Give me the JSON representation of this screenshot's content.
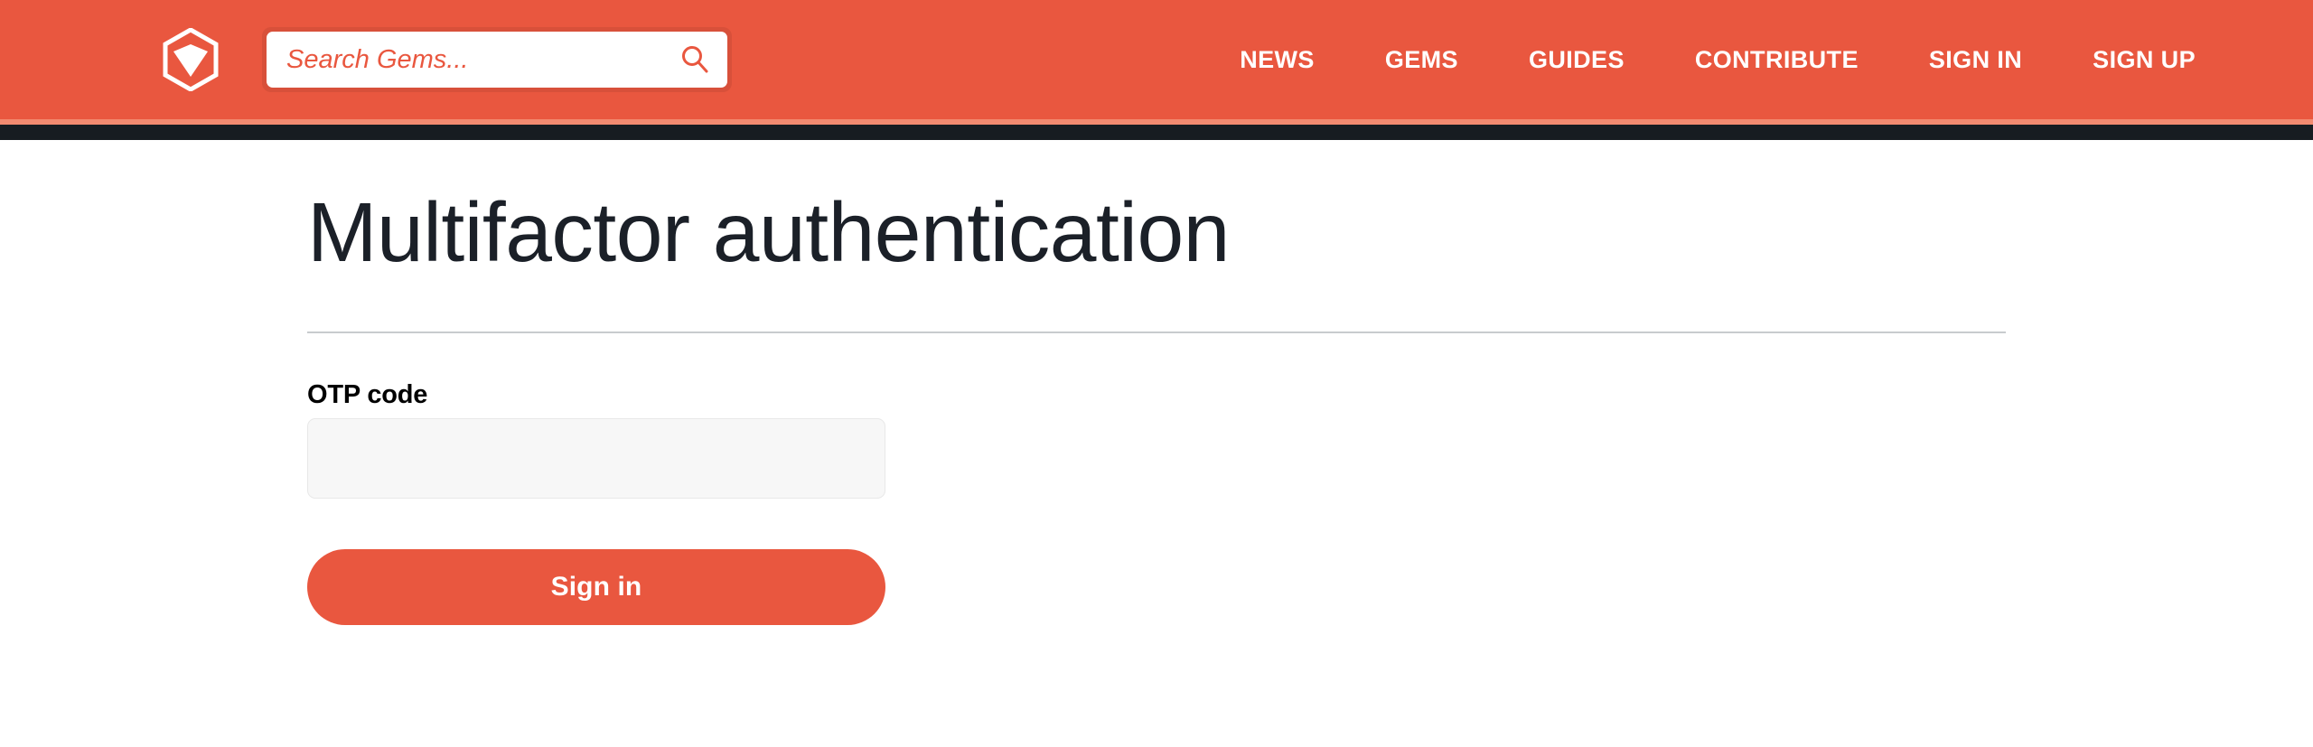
{
  "header": {
    "logo": {
      "icon": "rubygems-hexagon-gem-logo",
      "alt": "RubyGems"
    },
    "search": {
      "placeholder": "Search Gems...",
      "value": "",
      "submit_icon": "search-icon"
    },
    "nav": [
      {
        "label": "NEWS",
        "name": "news"
      },
      {
        "label": "GEMS",
        "name": "gems"
      },
      {
        "label": "GUIDES",
        "name": "guides"
      },
      {
        "label": "CONTRIBUTE",
        "name": "contribute"
      },
      {
        "label": "SIGN IN",
        "name": "sign-in"
      },
      {
        "label": "SIGN UP",
        "name": "sign-up"
      }
    ]
  },
  "main": {
    "title": "Multifactor authentication",
    "form": {
      "otp_label": "OTP code",
      "otp_value": "",
      "otp_placeholder": "",
      "submit_label": "Sign in"
    }
  },
  "colors": {
    "brand_orange": "#e9573f",
    "brand_orange_dark": "#d8503a",
    "brand_salmon": "#f28a70",
    "dark_navy": "#171c21",
    "rule_gray": "#c8cbce",
    "input_bg": "#f7f7f7",
    "input_border": "#e8e8e8",
    "title_text": "#1b2028"
  }
}
